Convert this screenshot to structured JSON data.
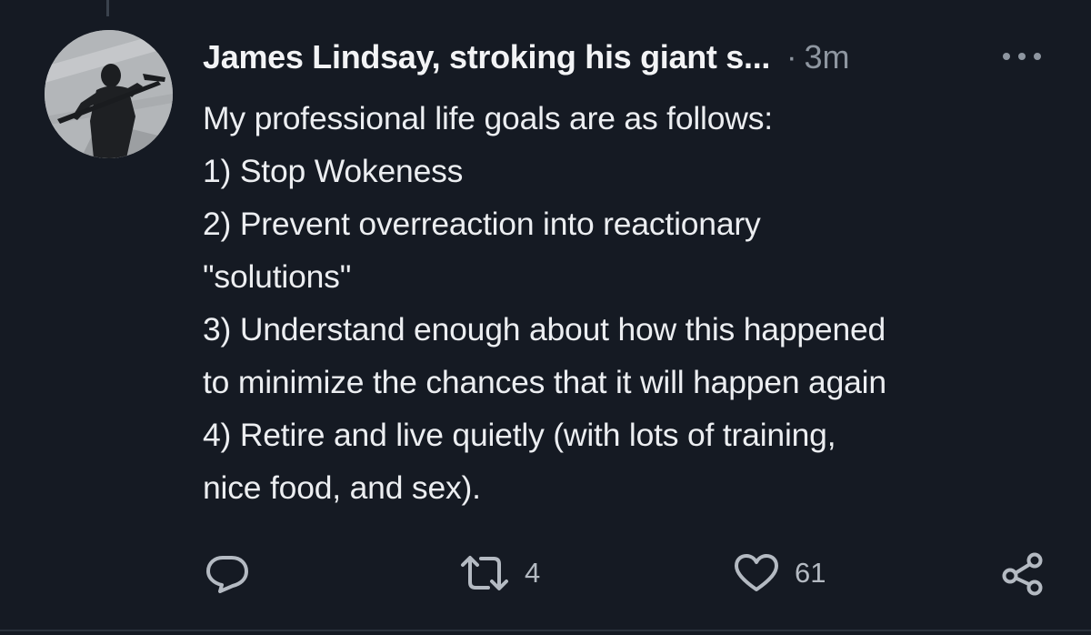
{
  "tweet": {
    "author": {
      "display_name": "James Lindsay, stroking his giant s...",
      "avatar_icon": "silhouette-with-sword-avatar"
    },
    "separator": "·",
    "timestamp": "3m",
    "more_icon": "more-dots-icon",
    "text_lines": [
      "My professional life goals are as follows:",
      "1) Stop Wokeness",
      "2) Prevent overreaction into reactionary",
      "\"solutions\"",
      "3) Understand enough about how this happened",
      "to minimize the chances that it will happen again",
      "4) Retire and live quietly (with lots of training,",
      "nice food, and sex)."
    ],
    "actions": {
      "reply": {
        "icon": "reply-icon"
      },
      "retweet": {
        "icon": "retweet-icon",
        "count": "4"
      },
      "like": {
        "icon": "heart-icon",
        "count": "61"
      },
      "share": {
        "icon": "share-icon"
      }
    }
  },
  "colors": {
    "background": "#151a23",
    "text": "#eceef1",
    "muted": "#8e96a0",
    "icon": "#b4bac2"
  }
}
